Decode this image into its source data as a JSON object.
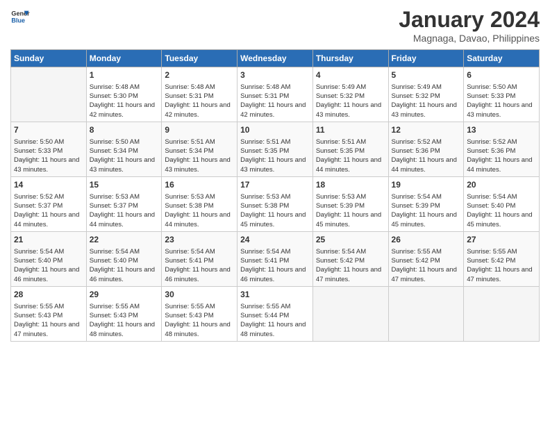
{
  "logo": {
    "text_general": "General",
    "text_blue": "Blue"
  },
  "header": {
    "month": "January 2024",
    "location": "Magnaga, Davao, Philippines"
  },
  "days_of_week": [
    "Sunday",
    "Monday",
    "Tuesday",
    "Wednesday",
    "Thursday",
    "Friday",
    "Saturday"
  ],
  "weeks": [
    [
      {
        "day": "",
        "sunrise": "",
        "sunset": "",
        "daylight": ""
      },
      {
        "day": "1",
        "sunrise": "Sunrise: 5:48 AM",
        "sunset": "Sunset: 5:30 PM",
        "daylight": "Daylight: 11 hours and 42 minutes."
      },
      {
        "day": "2",
        "sunrise": "Sunrise: 5:48 AM",
        "sunset": "Sunset: 5:31 PM",
        "daylight": "Daylight: 11 hours and 42 minutes."
      },
      {
        "day": "3",
        "sunrise": "Sunrise: 5:48 AM",
        "sunset": "Sunset: 5:31 PM",
        "daylight": "Daylight: 11 hours and 42 minutes."
      },
      {
        "day": "4",
        "sunrise": "Sunrise: 5:49 AM",
        "sunset": "Sunset: 5:32 PM",
        "daylight": "Daylight: 11 hours and 43 minutes."
      },
      {
        "day": "5",
        "sunrise": "Sunrise: 5:49 AM",
        "sunset": "Sunset: 5:32 PM",
        "daylight": "Daylight: 11 hours and 43 minutes."
      },
      {
        "day": "6",
        "sunrise": "Sunrise: 5:50 AM",
        "sunset": "Sunset: 5:33 PM",
        "daylight": "Daylight: 11 hours and 43 minutes."
      }
    ],
    [
      {
        "day": "7",
        "sunrise": "Sunrise: 5:50 AM",
        "sunset": "Sunset: 5:33 PM",
        "daylight": "Daylight: 11 hours and 43 minutes."
      },
      {
        "day": "8",
        "sunrise": "Sunrise: 5:50 AM",
        "sunset": "Sunset: 5:34 PM",
        "daylight": "Daylight: 11 hours and 43 minutes."
      },
      {
        "day": "9",
        "sunrise": "Sunrise: 5:51 AM",
        "sunset": "Sunset: 5:34 PM",
        "daylight": "Daylight: 11 hours and 43 minutes."
      },
      {
        "day": "10",
        "sunrise": "Sunrise: 5:51 AM",
        "sunset": "Sunset: 5:35 PM",
        "daylight": "Daylight: 11 hours and 43 minutes."
      },
      {
        "day": "11",
        "sunrise": "Sunrise: 5:51 AM",
        "sunset": "Sunset: 5:35 PM",
        "daylight": "Daylight: 11 hours and 44 minutes."
      },
      {
        "day": "12",
        "sunrise": "Sunrise: 5:52 AM",
        "sunset": "Sunset: 5:36 PM",
        "daylight": "Daylight: 11 hours and 44 minutes."
      },
      {
        "day": "13",
        "sunrise": "Sunrise: 5:52 AM",
        "sunset": "Sunset: 5:36 PM",
        "daylight": "Daylight: 11 hours and 44 minutes."
      }
    ],
    [
      {
        "day": "14",
        "sunrise": "Sunrise: 5:52 AM",
        "sunset": "Sunset: 5:37 PM",
        "daylight": "Daylight: 11 hours and 44 minutes."
      },
      {
        "day": "15",
        "sunrise": "Sunrise: 5:53 AM",
        "sunset": "Sunset: 5:37 PM",
        "daylight": "Daylight: 11 hours and 44 minutes."
      },
      {
        "day": "16",
        "sunrise": "Sunrise: 5:53 AM",
        "sunset": "Sunset: 5:38 PM",
        "daylight": "Daylight: 11 hours and 44 minutes."
      },
      {
        "day": "17",
        "sunrise": "Sunrise: 5:53 AM",
        "sunset": "Sunset: 5:38 PM",
        "daylight": "Daylight: 11 hours and 45 minutes."
      },
      {
        "day": "18",
        "sunrise": "Sunrise: 5:53 AM",
        "sunset": "Sunset: 5:39 PM",
        "daylight": "Daylight: 11 hours and 45 minutes."
      },
      {
        "day": "19",
        "sunrise": "Sunrise: 5:54 AM",
        "sunset": "Sunset: 5:39 PM",
        "daylight": "Daylight: 11 hours and 45 minutes."
      },
      {
        "day": "20",
        "sunrise": "Sunrise: 5:54 AM",
        "sunset": "Sunset: 5:40 PM",
        "daylight": "Daylight: 11 hours and 45 minutes."
      }
    ],
    [
      {
        "day": "21",
        "sunrise": "Sunrise: 5:54 AM",
        "sunset": "Sunset: 5:40 PM",
        "daylight": "Daylight: 11 hours and 46 minutes."
      },
      {
        "day": "22",
        "sunrise": "Sunrise: 5:54 AM",
        "sunset": "Sunset: 5:40 PM",
        "daylight": "Daylight: 11 hours and 46 minutes."
      },
      {
        "day": "23",
        "sunrise": "Sunrise: 5:54 AM",
        "sunset": "Sunset: 5:41 PM",
        "daylight": "Daylight: 11 hours and 46 minutes."
      },
      {
        "day": "24",
        "sunrise": "Sunrise: 5:54 AM",
        "sunset": "Sunset: 5:41 PM",
        "daylight": "Daylight: 11 hours and 46 minutes."
      },
      {
        "day": "25",
        "sunrise": "Sunrise: 5:54 AM",
        "sunset": "Sunset: 5:42 PM",
        "daylight": "Daylight: 11 hours and 47 minutes."
      },
      {
        "day": "26",
        "sunrise": "Sunrise: 5:55 AM",
        "sunset": "Sunset: 5:42 PM",
        "daylight": "Daylight: 11 hours and 47 minutes."
      },
      {
        "day": "27",
        "sunrise": "Sunrise: 5:55 AM",
        "sunset": "Sunset: 5:42 PM",
        "daylight": "Daylight: 11 hours and 47 minutes."
      }
    ],
    [
      {
        "day": "28",
        "sunrise": "Sunrise: 5:55 AM",
        "sunset": "Sunset: 5:43 PM",
        "daylight": "Daylight: 11 hours and 47 minutes."
      },
      {
        "day": "29",
        "sunrise": "Sunrise: 5:55 AM",
        "sunset": "Sunset: 5:43 PM",
        "daylight": "Daylight: 11 hours and 48 minutes."
      },
      {
        "day": "30",
        "sunrise": "Sunrise: 5:55 AM",
        "sunset": "Sunset: 5:43 PM",
        "daylight": "Daylight: 11 hours and 48 minutes."
      },
      {
        "day": "31",
        "sunrise": "Sunrise: 5:55 AM",
        "sunset": "Sunset: 5:44 PM",
        "daylight": "Daylight: 11 hours and 48 minutes."
      },
      {
        "day": "",
        "sunrise": "",
        "sunset": "",
        "daylight": ""
      },
      {
        "day": "",
        "sunrise": "",
        "sunset": "",
        "daylight": ""
      },
      {
        "day": "",
        "sunrise": "",
        "sunset": "",
        "daylight": ""
      }
    ]
  ]
}
